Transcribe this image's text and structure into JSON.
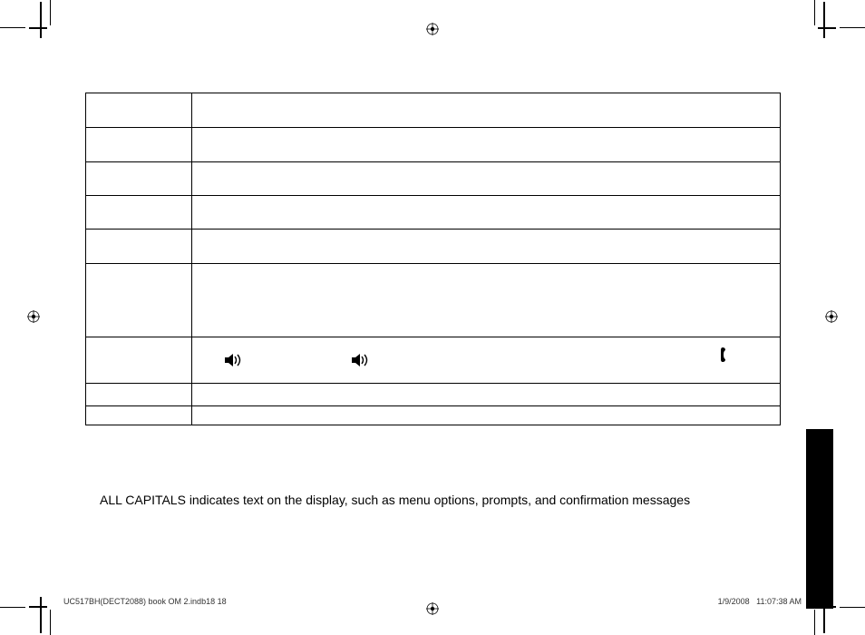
{
  "note": "ALL CAPITALS indicates text on the display, such as menu options, prompts, and confirmation messages",
  "footer": {
    "left": "UC517BH(DECT2088) book OM 2.indb18   18",
    "date": "1/9/2008",
    "time": "11:07:38 AM"
  },
  "icons": {
    "speaker": "speaker-icon",
    "handset": "handset-icon",
    "registration": "registration-target-icon"
  }
}
